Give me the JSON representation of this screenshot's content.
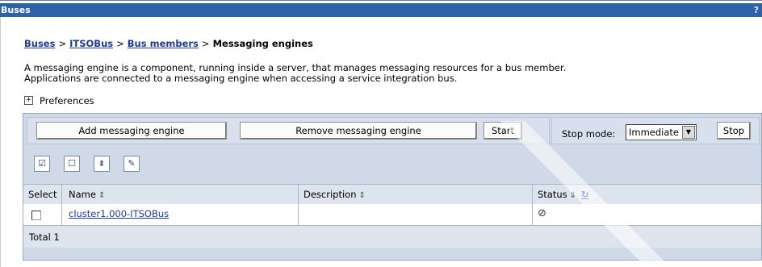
{
  "window": {
    "title": "Buses",
    "help": "?"
  },
  "breadcrumb": {
    "items": [
      "Buses",
      "ITSOBus",
      "Bus members"
    ],
    "separator": ">",
    "current": "Messaging engines"
  },
  "description": {
    "line1": "A messaging engine is a component, running inside a server, that manages messaging resources for a bus member.",
    "line2": "Applications are connected to a messaging engine when accessing a service integration bus."
  },
  "preferences": {
    "expand_glyph": "+",
    "label": "Preferences"
  },
  "buttons": {
    "add": "Add messaging engine",
    "remove": "Remove messaging engine",
    "start": "Start",
    "stop": "Stop"
  },
  "stop_mode": {
    "label": "Stop mode:",
    "selected": "Immediate"
  },
  "toolbar_icons": [
    "select-all-icon",
    "deselect-all-icon",
    "show-filter-icon",
    "clear-filter-icon"
  ],
  "table": {
    "columns": [
      "Select",
      "Name",
      "Description",
      "Status"
    ],
    "sort_glyph": "⇕",
    "refresh_glyph": "↻",
    "rows": [
      {
        "name": "cluster1.000-ITSOBus",
        "description": "",
        "status_glyph": "⊘"
      }
    ],
    "total": "Total 1"
  },
  "colors": {
    "title_bar": "#2e62a8",
    "panel": "#cfd9e7",
    "header_row": "#dde4ee",
    "link": "#1f3b8c"
  }
}
